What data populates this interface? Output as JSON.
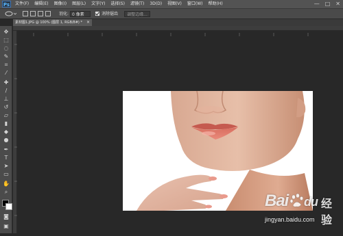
{
  "app": {
    "logo": "Ps"
  },
  "menu": {
    "items": [
      "文件(F)",
      "编辑(E)",
      "图像(I)",
      "图层(L)",
      "文字(Y)",
      "选择(S)",
      "滤镜(T)",
      "3D(D)",
      "视图(V)",
      "窗口(W)",
      "帮助(H)"
    ]
  },
  "window_controls": {
    "minimize": "—",
    "maximize": "□",
    "close": "✕"
  },
  "options_bar": {
    "feather_label": "羽化:",
    "feather_value": "0 像素",
    "antialias_label": "消除锯齿",
    "antialias_checked": true,
    "refine_edge_button": "调整边缘..."
  },
  "document_tab": {
    "title": "素材图1.JPG @ 100% (图层 1, RGB/8#) *",
    "close": "×"
  },
  "watermark": {
    "brand": "Bai",
    "brand_paw": "du",
    "jingyan": "经验",
    "url": "jingyan.baidu.com"
  },
  "colors": {
    "menubar_bg": "#535353",
    "workspace_bg": "#282828",
    "ps_blue": "#58b7ff"
  },
  "tools": [
    "move-tool",
    "marquee-tool",
    "lasso-tool",
    "quick-select-tool",
    "crop-tool",
    "eyedropper-tool",
    "healing-brush-tool",
    "brush-tool",
    "clone-stamp-tool",
    "history-brush-tool",
    "eraser-tool",
    "gradient-tool",
    "blur-tool",
    "dodge-tool",
    "pen-tool",
    "type-tool",
    "path-select-tool",
    "shape-tool",
    "hand-tool",
    "zoom-tool"
  ]
}
